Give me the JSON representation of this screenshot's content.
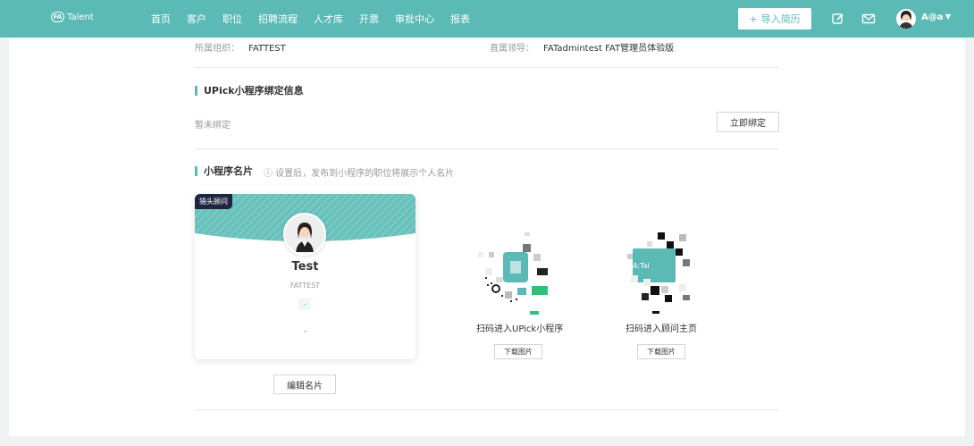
{
  "brand": {
    "logo_mark": "FA",
    "logo_text": "Talent",
    "accent": "#5bbab5"
  },
  "nav": {
    "items": [
      "首页",
      "客户",
      "职位",
      "招聘流程",
      "人才库",
      "开票",
      "审批中心",
      "报表"
    ]
  },
  "header": {
    "import_label": "导入简历",
    "user_name": "A@a",
    "caret": "▼"
  },
  "info": {
    "org_label": "所属组织：",
    "org_value": "FATTEST",
    "leader_label": "直属领导：",
    "leader_value": "FATadmintest FAT管理员体验版"
  },
  "upick": {
    "title": "UPick小程序绑定信息",
    "status": "暂未绑定",
    "bind_button": "立即绑定"
  },
  "mini_card": {
    "title": "小程序名片",
    "hint": "ⓘ 设置后，发布到小程序的职位将展示个人名片",
    "badge": "猎头顾问",
    "name": "Test",
    "org": "FATTEST",
    "tag": "-",
    "note": "-",
    "edit_button": "编辑名片"
  },
  "qr_codes": {
    "upick_label": "扫码进入UPick小程序",
    "upick_download": "下载图片",
    "consultant_label": "扫码进入顾问主页",
    "consultant_download": "下载图片",
    "consultant_logo": "A:Tal"
  }
}
